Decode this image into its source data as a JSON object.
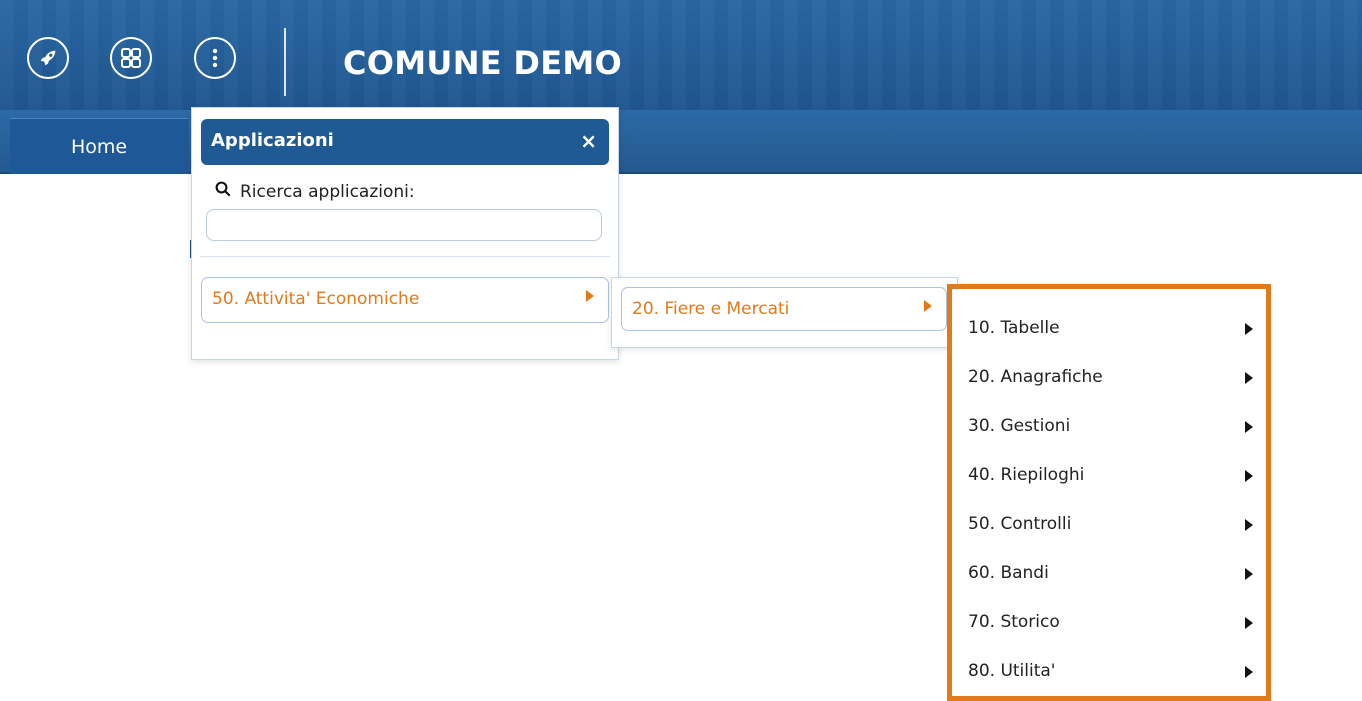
{
  "header": {
    "title": "COMUNE DEMO",
    "buttons": [
      {
        "icon": "rocket-icon"
      },
      {
        "icon": "apps-grid-icon"
      },
      {
        "icon": "more-vertical-icon"
      }
    ]
  },
  "tabs": [
    {
      "label": "Home"
    }
  ],
  "apps_panel": {
    "title": "Applicazioni",
    "close_label": "×",
    "search_label": "Ricerca applicazioni:",
    "search_value": "",
    "search_placeholder": "",
    "items": [
      {
        "label": "50. Attivita' Economiche"
      }
    ]
  },
  "submenu_1": {
    "items": [
      {
        "label": "20. Fiere e Mercati"
      }
    ]
  },
  "submenu_2": {
    "items": [
      {
        "label": "10. Tabelle"
      },
      {
        "label": "20. Anagrafiche"
      },
      {
        "label": "30. Gestioni"
      },
      {
        "label": "40. Riepiloghi"
      },
      {
        "label": "50. Controlli"
      },
      {
        "label": "60. Bandi"
      },
      {
        "label": "70. Storico"
      },
      {
        "label": "80. Utilita'"
      }
    ]
  },
  "colors": {
    "header_blue": "#255f9a",
    "panel_blue": "#1f5a94",
    "accent_orange": "#e07a1b"
  }
}
